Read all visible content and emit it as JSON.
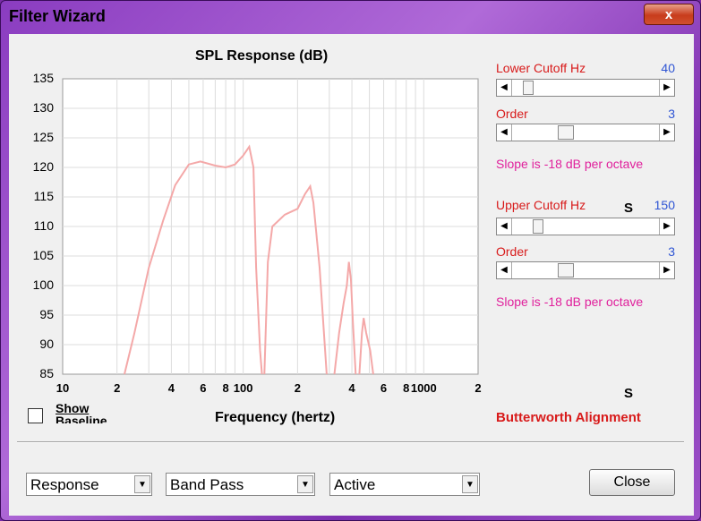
{
  "window": {
    "title": "Filter Wizard",
    "close_glyph": "x"
  },
  "chart_data": {
    "type": "line",
    "title": "SPL Response (dB)",
    "xlabel": "Frequency (hertz)",
    "x_scale": "log",
    "xlim": [
      10,
      2000
    ],
    "ylim": [
      85,
      135
    ],
    "y_ticks": [
      "135",
      "130",
      "125",
      "120",
      "115",
      "110",
      "105",
      "100",
      "95",
      "90",
      "85"
    ],
    "x_ticks": [
      {
        "value": 10,
        "label": "10"
      },
      {
        "value": 20,
        "label": "2"
      },
      {
        "value": 40,
        "label": "4"
      },
      {
        "value": 60,
        "label": "6"
      },
      {
        "value": 80,
        "label": "8"
      },
      {
        "value": 100,
        "label": "100"
      },
      {
        "value": 200,
        "label": "2"
      },
      {
        "value": 400,
        "label": "4"
      },
      {
        "value": 600,
        "label": "6"
      },
      {
        "value": 800,
        "label": "8"
      },
      {
        "value": 1000,
        "label": "1000"
      },
      {
        "value": 2000,
        "label": "2"
      }
    ],
    "grid": true,
    "line_color": "#f4a8a8",
    "series": [
      {
        "points": [
          [
            22,
            85
          ],
          [
            25,
            92
          ],
          [
            30,
            103
          ],
          [
            36,
            111
          ],
          [
            42,
            117
          ],
          [
            50,
            120.5
          ],
          [
            58,
            121
          ],
          [
            70,
            120.3
          ],
          [
            80,
            120
          ],
          [
            90,
            120.5
          ],
          [
            100,
            122
          ],
          [
            108,
            123.5
          ],
          [
            114,
            120
          ],
          [
            118,
            103
          ],
          [
            124,
            89
          ],
          [
            127,
            85
          ]
        ]
      },
      {
        "points": [
          [
            131,
            85
          ],
          [
            137,
            104
          ],
          [
            145,
            110
          ],
          [
            170,
            112
          ],
          [
            200,
            113
          ],
          [
            220,
            115.5
          ],
          [
            235,
            116.8
          ],
          [
            245,
            114
          ],
          [
            265,
            103
          ],
          [
            290,
            85
          ]
        ]
      },
      {
        "points": [
          [
            320,
            85
          ],
          [
            340,
            92
          ],
          [
            360,
            97
          ],
          [
            375,
            100
          ],
          [
            385,
            104
          ],
          [
            395,
            101
          ],
          [
            405,
            94
          ],
          [
            420,
            85
          ]
        ]
      },
      {
        "points": [
          [
            440,
            85
          ],
          [
            455,
            92
          ],
          [
            465,
            94.5
          ],
          [
            480,
            92
          ],
          [
            505,
            89
          ],
          [
            525,
            85
          ]
        ]
      }
    ]
  },
  "checkbox": {
    "label_line1": "Show",
    "label_line2": "Baseline"
  },
  "controls": {
    "lower_cutoff_label": "Lower Cutoff  Hz",
    "lower_cutoff_value": "40",
    "lower_cutoff_fraction": 0.08,
    "lower_order_label": "Order",
    "lower_order_value": "3",
    "lower_order_fraction": 0.35,
    "lower_slope": "Slope is -18 dB per octave",
    "upper_cutoff_label": "Upper Cutoff  Hz",
    "upper_cutoff_value": "150",
    "upper_cutoff_fraction": 0.15,
    "upper_order_label": "Order",
    "upper_order_value": "3",
    "upper_order_fraction": 0.35,
    "upper_slope": "Slope is -18 dB per octave",
    "s_marker_1": "S",
    "s_marker_2": "S",
    "alignment": "Butterworth Alignment"
  },
  "bottom": {
    "select_view": "Response",
    "select_type": "Band Pass",
    "select_mode": "Active",
    "close_label": "Close"
  },
  "icons": {
    "left": "scroll-left-icon",
    "right": "scroll-right-icon",
    "dropdown": "chevron-down-icon"
  }
}
